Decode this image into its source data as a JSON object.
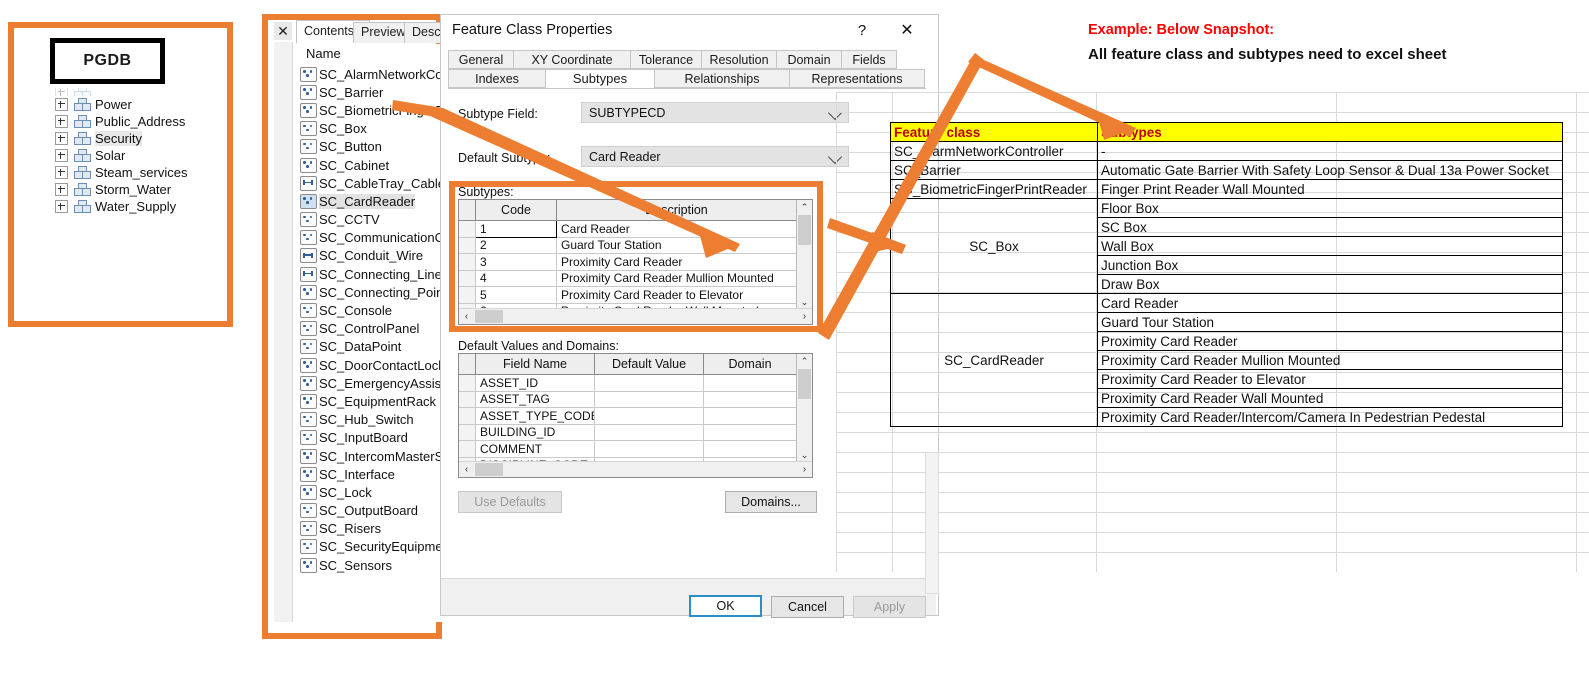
{
  "annotation": {
    "note_line1": "Example: Below Snapshot:",
    "note_line2": "All feature class and subtypes need to excel sheet",
    "accent_color": "#ED7D31",
    "note1_color": "#FF0000"
  },
  "pgdb_panel": {
    "label": "PGDB",
    "tree_items": [
      {
        "label": "Power",
        "selected": false
      },
      {
        "label": "Public_Address",
        "selected": false
      },
      {
        "label": "Security",
        "selected": true
      },
      {
        "label": "Solar",
        "selected": false
      },
      {
        "label": "Steam_services",
        "selected": false
      },
      {
        "label": "Storm_Water",
        "selected": false
      },
      {
        "label": "Water_Supply",
        "selected": false
      }
    ]
  },
  "catalog": {
    "close_label": "✕",
    "tabs": [
      {
        "label": "Contents",
        "active": true
      },
      {
        "label": "Preview",
        "active": false
      },
      {
        "label": "Descr",
        "active": false
      }
    ],
    "column_header": "Name",
    "feature_classes": [
      {
        "label": "SC_AlarmNetworkCo",
        "type": "point",
        "selected": false
      },
      {
        "label": "SC_Barrier",
        "type": "point",
        "selected": false
      },
      {
        "label": "SC_BiometricFingerPr",
        "type": "point",
        "selected": false
      },
      {
        "label": "SC_Box",
        "type": "point",
        "selected": false
      },
      {
        "label": "SC_Button",
        "type": "point",
        "selected": false
      },
      {
        "label": "SC_Cabinet",
        "type": "point",
        "selected": false
      },
      {
        "label": "SC_CableTray_Cable",
        "type": "line",
        "selected": false
      },
      {
        "label": "SC_CardReader",
        "type": "point",
        "selected": true
      },
      {
        "label": "SC_CCTV",
        "type": "point",
        "selected": false
      },
      {
        "label": "SC_CommunicationC",
        "type": "point",
        "selected": false
      },
      {
        "label": "SC_Conduit_Wire",
        "type": "line",
        "selected": false
      },
      {
        "label": "SC_Connecting_Lines",
        "type": "line",
        "selected": false
      },
      {
        "label": "SC_Connecting_Point",
        "type": "point",
        "selected": false
      },
      {
        "label": "SC_Console",
        "type": "point",
        "selected": false
      },
      {
        "label": "SC_ControlPanel",
        "type": "point",
        "selected": false
      },
      {
        "label": "SC_DataPoint",
        "type": "point",
        "selected": false
      },
      {
        "label": "SC_DoorContactLock",
        "type": "point",
        "selected": false
      },
      {
        "label": "SC_EmergencyAssista",
        "type": "point",
        "selected": false
      },
      {
        "label": "SC_EquipmentRack",
        "type": "point",
        "selected": false
      },
      {
        "label": "SC_Hub_Switch",
        "type": "point",
        "selected": false
      },
      {
        "label": "SC_InputBoard",
        "type": "point",
        "selected": false
      },
      {
        "label": "SC_IntercomMasterSt",
        "type": "point",
        "selected": false
      },
      {
        "label": "SC_Interface",
        "type": "point",
        "selected": false
      },
      {
        "label": "SC_Lock",
        "type": "point",
        "selected": false
      },
      {
        "label": "SC_OutputBoard",
        "type": "point",
        "selected": false
      },
      {
        "label": "SC_Risers",
        "type": "point",
        "selected": false
      },
      {
        "label": "SC_SecurityEquipmen",
        "type": "point",
        "selected": false
      },
      {
        "label": "SC_Sensors",
        "type": "point",
        "selected": false
      }
    ]
  },
  "dialog": {
    "title": "Feature Class Properties",
    "help_label": "?",
    "close_label": "✕",
    "tabs_row1": [
      {
        "label": "General",
        "active": false
      },
      {
        "label": "XY Coordinate System",
        "active": false
      },
      {
        "label": "Tolerance",
        "active": false
      },
      {
        "label": "Resolution",
        "active": false
      },
      {
        "label": "Domain",
        "active": false
      },
      {
        "label": "Fields",
        "active": false
      }
    ],
    "tabs_row2": [
      {
        "label": "Indexes",
        "active": false
      },
      {
        "label": "Subtypes",
        "active": true
      },
      {
        "label": "Relationships",
        "active": false
      },
      {
        "label": "Representations",
        "active": false
      }
    ],
    "subtype_field_label": "Subtype Field:",
    "subtype_field_value": "SUBTYPECD",
    "default_subtype_label": "Default Subtype:",
    "default_subtype_value": "Card Reader",
    "subtypes_caption": "Subtypes:",
    "subtypes_columns": [
      "Code",
      "Description"
    ],
    "subtypes_rows": [
      {
        "code": "1",
        "description": "Card Reader"
      },
      {
        "code": "2",
        "description": "Guard Tour Station"
      },
      {
        "code": "3",
        "description": "Proximity Card Reader"
      },
      {
        "code": "4",
        "description": "Proximity Card Reader Mullion Mounted"
      },
      {
        "code": "5",
        "description": "Proximity Card Reader to Elevator"
      },
      {
        "code": "6",
        "description": "Proximity Card Reader Wall Mounted"
      }
    ],
    "defaults_caption": "Default Values and Domains:",
    "defaults_columns": [
      "Field Name",
      "Default Value",
      "Domain"
    ],
    "defaults_rows": [
      {
        "field": "ASSET_ID",
        "value": "",
        "domain": ""
      },
      {
        "field": "ASSET_TAG",
        "value": "",
        "domain": ""
      },
      {
        "field": "ASSET_TYPE_CODE",
        "value": "",
        "domain": ""
      },
      {
        "field": "BUILDING_ID",
        "value": "",
        "domain": ""
      },
      {
        "field": "COMMENT",
        "value": "",
        "domain": ""
      },
      {
        "field": "DISCIPLINE_CODE",
        "value": "",
        "domain": ""
      }
    ],
    "use_defaults_label": "Use Defaults",
    "domains_label": "Domains...",
    "ok_label": "OK",
    "cancel_label": "Cancel",
    "apply_label": "Apply"
  },
  "excel": {
    "headers": [
      "Feature class",
      "Subtypes"
    ],
    "header_bg": "#FFFF00",
    "header_fg": "#C00000",
    "rows": [
      {
        "feature_class": "SC_AlarmNetworkController",
        "span": 1,
        "subtypes": [
          "-"
        ]
      },
      {
        "feature_class": "SC_Barrier",
        "span": 1,
        "subtypes": [
          "Automatic Gate Barrier With Safety Loop Sensor & Dual 13a Power Socket"
        ]
      },
      {
        "feature_class": "SC_BiometricFingerPrintReader",
        "span": 1,
        "subtypes": [
          "Finger Print Reader Wall Mounted"
        ]
      },
      {
        "feature_class": "SC_Box",
        "span": 5,
        "subtypes": [
          "Floor Box",
          "SC Box",
          "Wall Box",
          "Junction Box",
          "Draw Box"
        ]
      },
      {
        "feature_class": "SC_CardReader",
        "span": 7,
        "subtypes": [
          "Card Reader",
          "Guard Tour Station",
          "Proximity Card Reader",
          "Proximity Card Reader Mullion Mounted",
          "Proximity Card Reader to Elevator",
          "Proximity Card Reader Wall Mounted",
          "Proximity Card Reader/Intercom/Camera In Pedestrian Pedestal"
        ]
      }
    ]
  }
}
